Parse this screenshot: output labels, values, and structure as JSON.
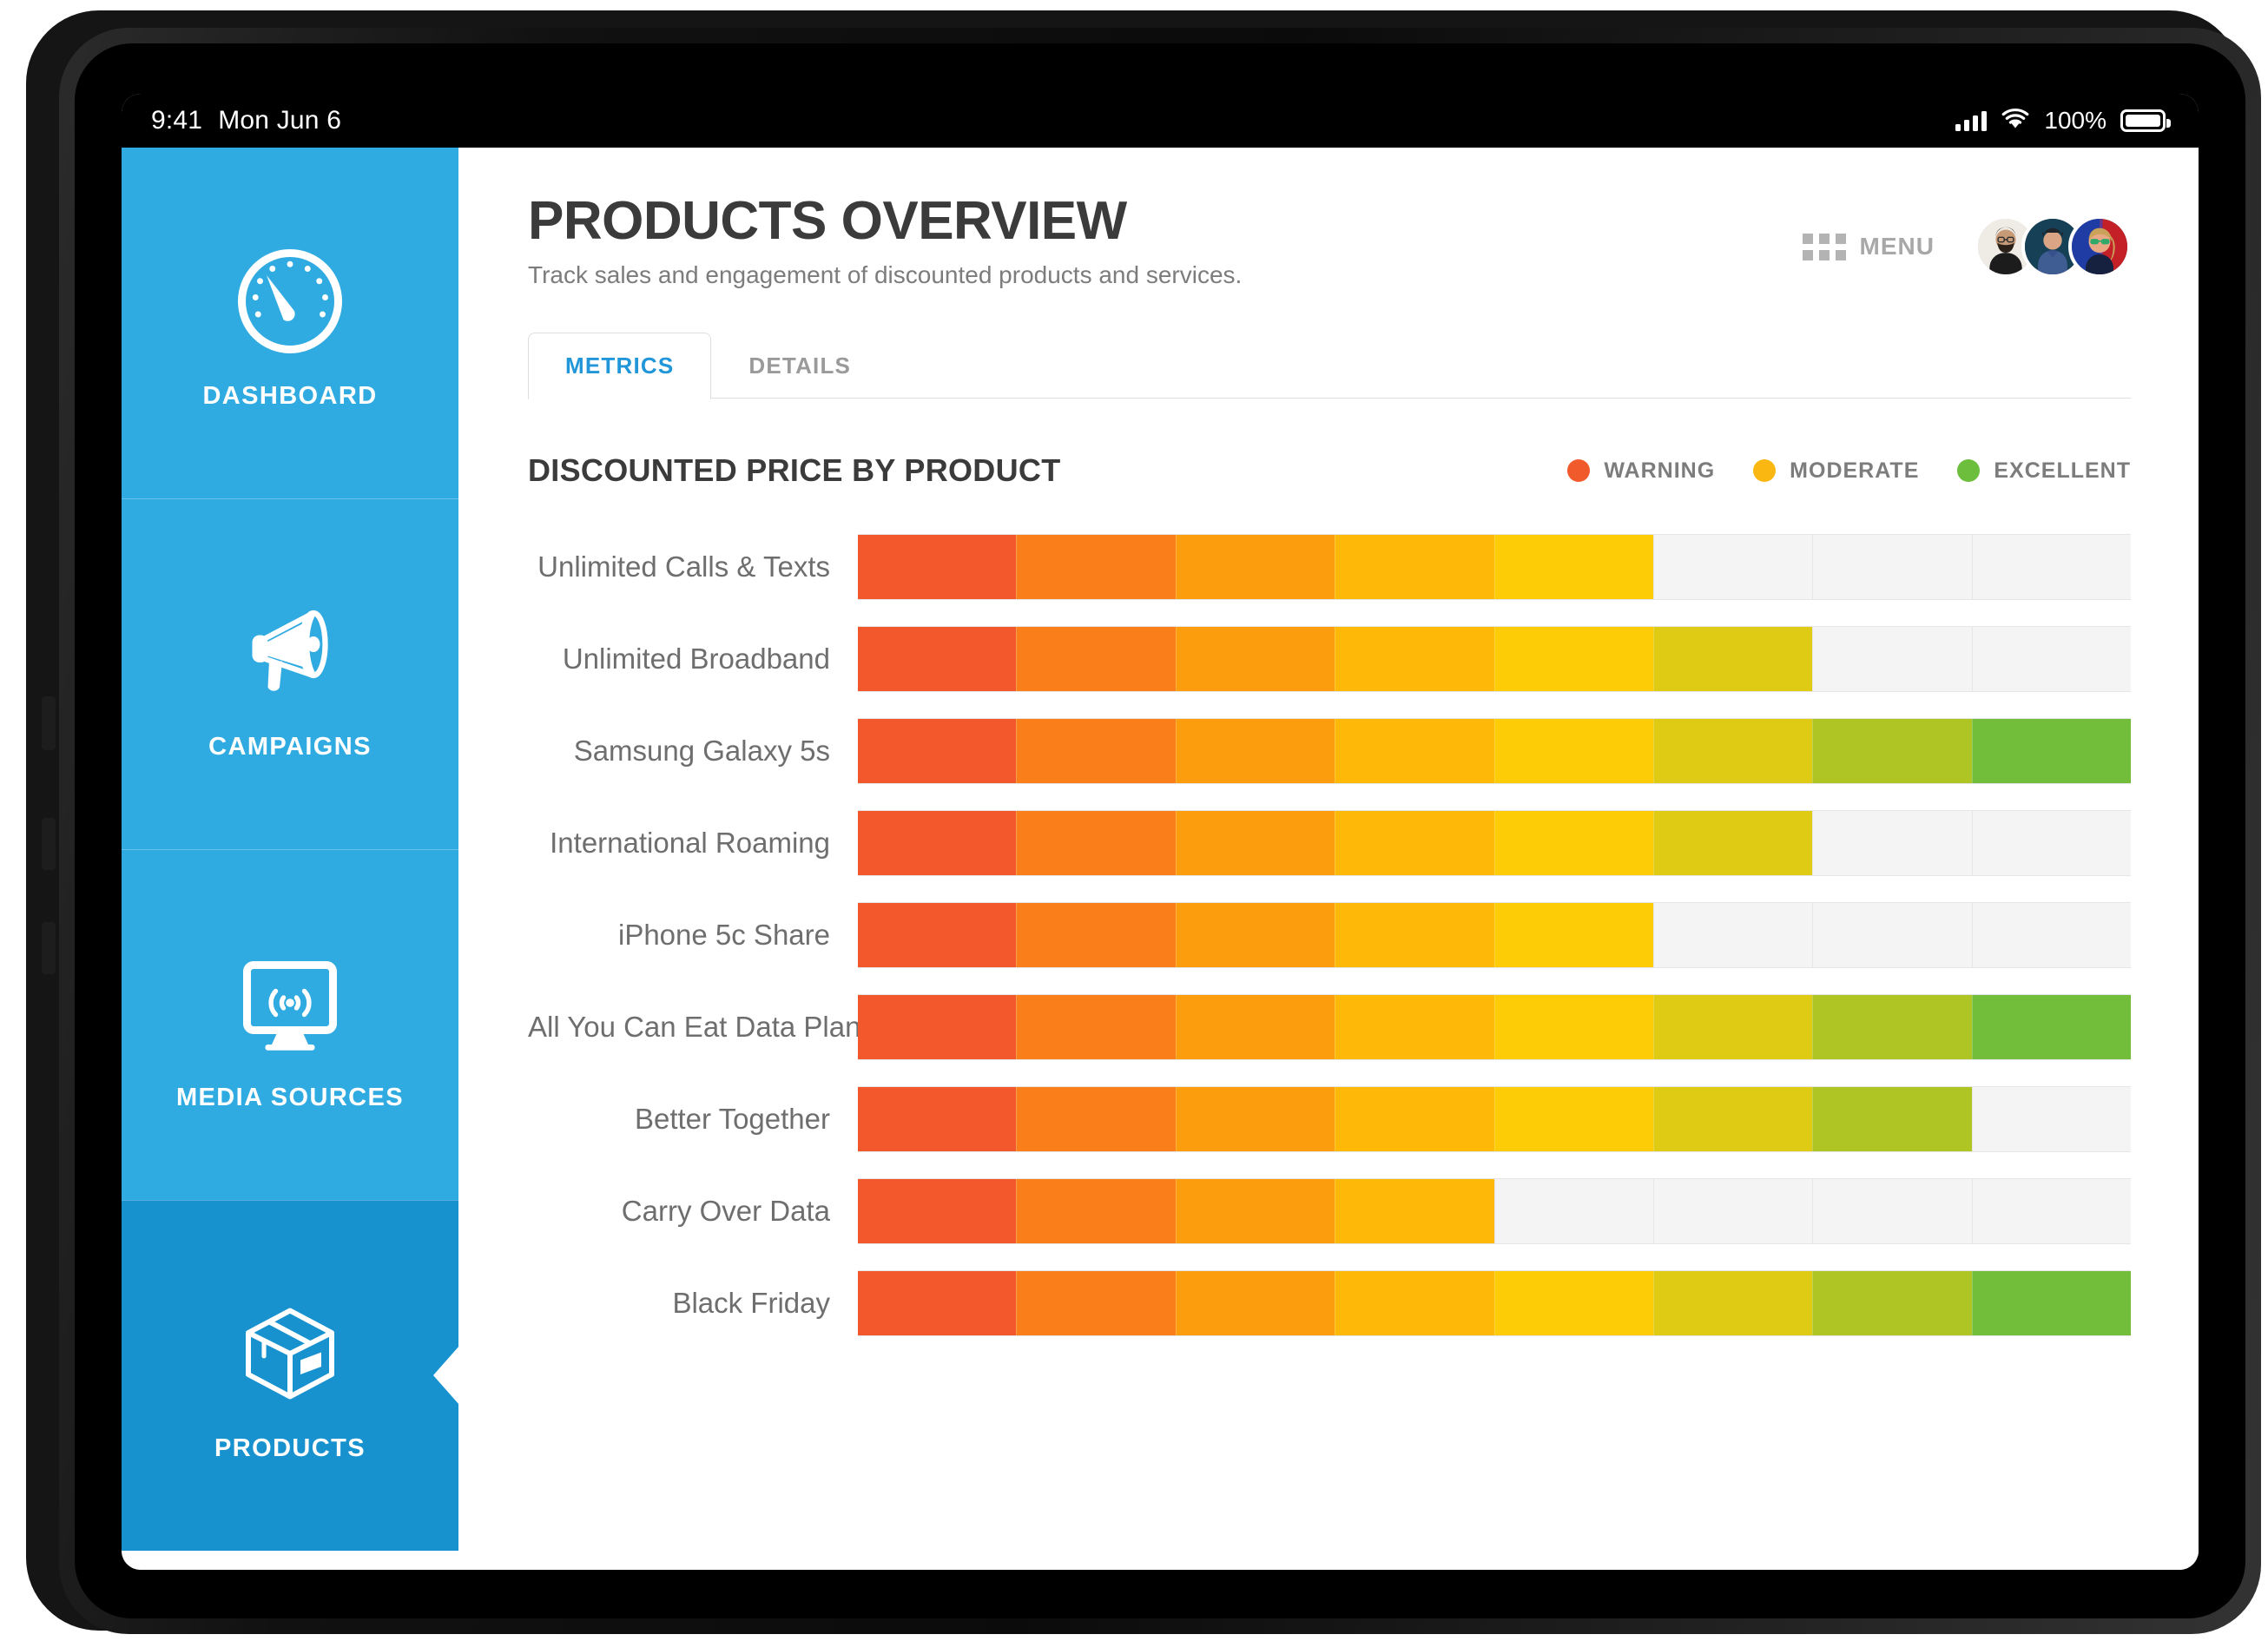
{
  "status_bar": {
    "time": "9:41",
    "date": "Mon Jun 6",
    "battery_percent": "100%",
    "icons": [
      "cellular-signal-icon",
      "wifi-icon",
      "battery-icon"
    ]
  },
  "sidebar": {
    "items": [
      {
        "label": "DASHBOARD",
        "icon": "speedometer-icon",
        "active": false
      },
      {
        "label": "CAMPAIGNS",
        "icon": "megaphone-icon",
        "active": false
      },
      {
        "label": "MEDIA SOURCES",
        "icon": "monitor-broadcast-icon",
        "active": false
      },
      {
        "label": "PRODUCTS",
        "icon": "package-box-icon",
        "active": true
      }
    ],
    "colors": {
      "base": "#30ABE2",
      "active": "#1792CF",
      "text": "#FFFFFF"
    }
  },
  "header": {
    "title": "PRODUCTS OVERVIEW",
    "subtitle": "Track sales and engagement of discounted products and services.",
    "menu_label": "MENU",
    "menu_icon": "grid-menu-icon",
    "avatars": [
      "avatar-user-1",
      "avatar-user-2",
      "avatar-user-3"
    ]
  },
  "tabs": [
    {
      "label": "METRICS",
      "active": true
    },
    {
      "label": "DETAILS",
      "active": false
    }
  ],
  "legend": [
    {
      "label": "WARNING",
      "color": "#F15A2B"
    },
    {
      "label": "MODERATE",
      "color": "#FBB711"
    },
    {
      "label": "EXCELLENT",
      "color": "#6CBE3C"
    }
  ],
  "chart_data": {
    "type": "bar",
    "title": "DISCOUNTED PRICE BY PRODUCT",
    "xlabel": "",
    "ylabel": "",
    "segments_per_bar": 8,
    "scale_max": 8,
    "grid": true,
    "legend_position": "top-right",
    "segment_colors": [
      "#F2582B",
      "#FA7F1A",
      "#FB9D0D",
      "#FDB808",
      "#FDCC06",
      "#E0CB14",
      "#AFC524",
      "#72BE3A"
    ],
    "track_color": "#F4F4F4",
    "categories": [
      "Unlimited Calls & Texts",
      "Unlimited Broadband",
      "Samsung Galaxy 5s",
      "International Roaming",
      "iPhone 5c Share",
      "All You Can Eat Data Plan",
      "Better Together",
      "Carry Over Data",
      "Black Friday"
    ],
    "values": [
      5,
      6,
      8,
      6,
      5,
      8,
      7,
      4,
      8
    ]
  }
}
